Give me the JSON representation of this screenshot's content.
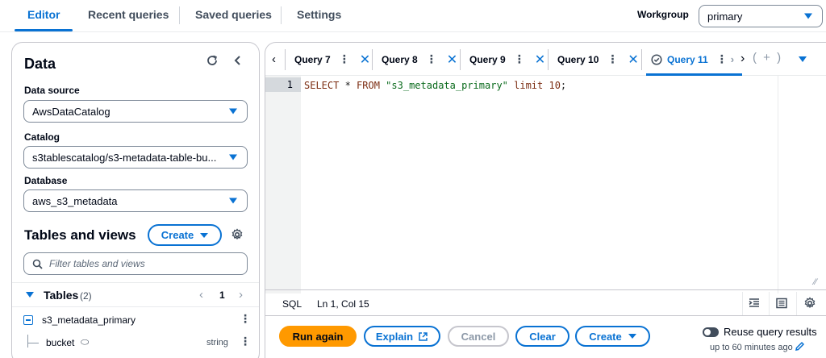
{
  "top_tabs": [
    {
      "label": "Editor",
      "active": true
    },
    {
      "label": "Recent queries",
      "active": false
    },
    {
      "label": "Saved queries",
      "active": false
    },
    {
      "label": "Settings",
      "active": false
    }
  ],
  "workgroup": {
    "label": "Workgroup",
    "value": "primary"
  },
  "data_panel": {
    "title": "Data",
    "data_source": {
      "label": "Data source",
      "value": "AwsDataCatalog"
    },
    "catalog": {
      "label": "Catalog",
      "value": "s3tablescatalog/s3-metadata-table-bu..."
    },
    "database": {
      "label": "Database",
      "value": "aws_s3_metadata"
    },
    "tables_and_views": {
      "title": "Tables and views",
      "create_label": "Create",
      "filter_placeholder": "Filter tables and views"
    },
    "tables": {
      "label": "Tables",
      "count": "(2)",
      "page": "1",
      "items": [
        {
          "name": "s3_metadata_primary",
          "columns": [
            {
              "name": "bucket",
              "type": "string"
            }
          ]
        }
      ]
    }
  },
  "query_tabs": [
    {
      "label": "Query 7",
      "active": false
    },
    {
      "label": "Query 8",
      "active": false
    },
    {
      "label": "Query 9",
      "active": false
    },
    {
      "label": "Query 10",
      "active": false
    },
    {
      "label": "Query 11",
      "active": true
    }
  ],
  "editor": {
    "line_number": "1",
    "code": {
      "kw1": "SELECT",
      "op": " * ",
      "kw2": "FROM ",
      "table": "\"s3_metadata_primary\"",
      "kw3": " limit ",
      "num": "10",
      "end": ";"
    }
  },
  "status": {
    "language": "SQL",
    "position": "Ln 1, Col 15"
  },
  "actions": {
    "run_again": "Run again",
    "explain": "Explain",
    "cancel": "Cancel",
    "clear": "Clear",
    "create": "Create",
    "reuse_label": "Reuse query results",
    "reuse_sub": "up to 60 minutes ago"
  },
  "colors": {
    "accent": "#0972d3",
    "primary_button": "#ff9900",
    "success": "#037f0c"
  }
}
